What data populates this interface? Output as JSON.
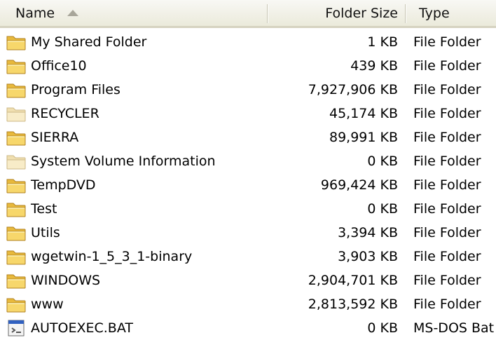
{
  "header": {
    "name": "Name",
    "size": "Folder Size",
    "type": "Type"
  },
  "files": [
    {
      "name": "My Shared Folder",
      "size": "1 KB",
      "type": "File Folder",
      "icon": "folder-icon"
    },
    {
      "name": "Office10",
      "size": "439 KB",
      "type": "File Folder",
      "icon": "folder-icon"
    },
    {
      "name": "Program Files",
      "size": "7,927,906 KB",
      "type": "File Folder",
      "icon": "folder-icon"
    },
    {
      "name": "RECYCLER",
      "size": "45,174 KB",
      "type": "File Folder",
      "icon": "hidden-folder-icon"
    },
    {
      "name": "SIERRA",
      "size": "89,991 KB",
      "type": "File Folder",
      "icon": "folder-icon"
    },
    {
      "name": "System Volume Information",
      "size": "0 KB",
      "type": "File Folder",
      "icon": "hidden-folder-icon"
    },
    {
      "name": "TempDVD",
      "size": "969,424 KB",
      "type": "File Folder",
      "icon": "folder-icon"
    },
    {
      "name": "Test",
      "size": "0 KB",
      "type": "File Folder",
      "icon": "folder-icon"
    },
    {
      "name": "Utils",
      "size": "3,394 KB",
      "type": "File Folder",
      "icon": "folder-icon"
    },
    {
      "name": "wgetwin-1_5_3_1-binary",
      "size": "3,903 KB",
      "type": "File Folder",
      "icon": "folder-icon"
    },
    {
      "name": "WINDOWS",
      "size": "2,904,701 KB",
      "type": "File Folder",
      "icon": "folder-icon"
    },
    {
      "name": "www",
      "size": "2,813,592 KB",
      "type": "File Folder",
      "icon": "folder-icon"
    },
    {
      "name": "AUTOEXEC.BAT",
      "size": "0 KB",
      "type": "MS-DOS Bat",
      "icon": "batch-file-icon"
    }
  ]
}
